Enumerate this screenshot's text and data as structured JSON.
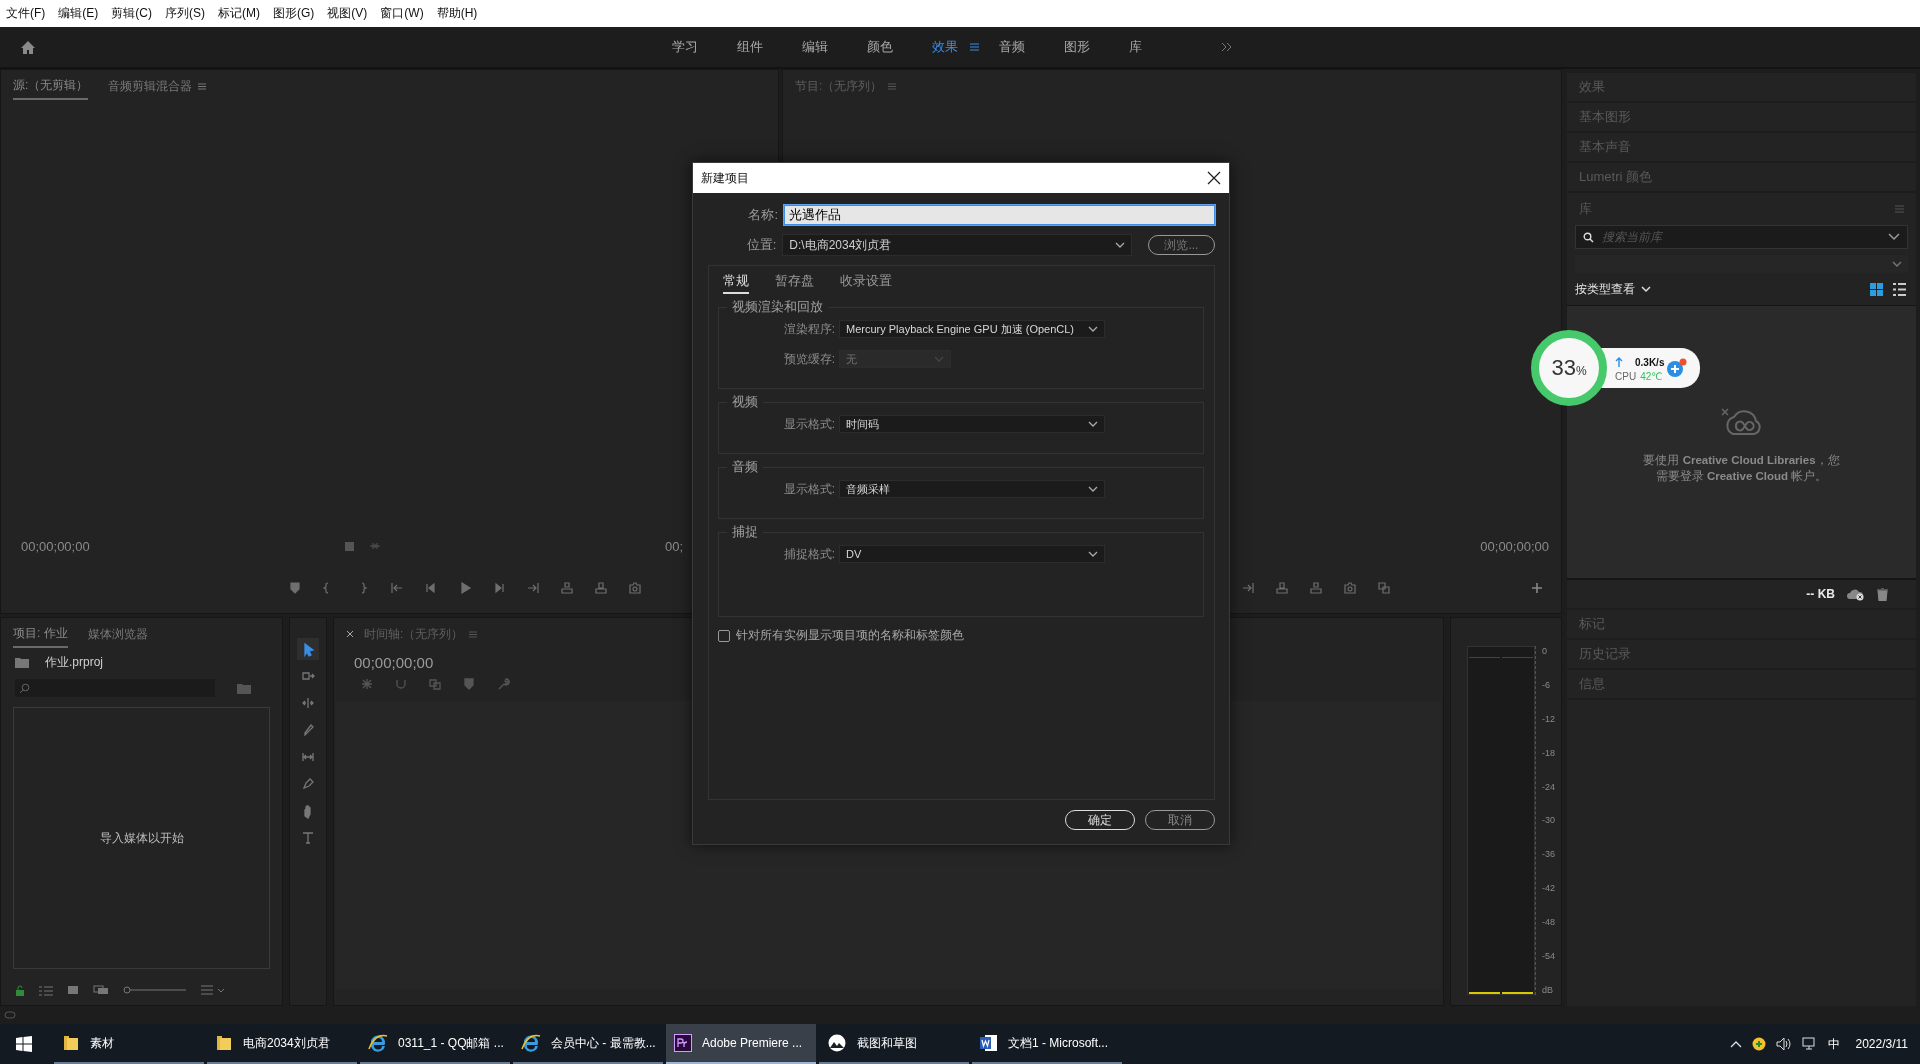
{
  "menu": [
    "文件(F)",
    "编辑(E)",
    "剪辑(C)",
    "序列(S)",
    "标记(M)",
    "图形(G)",
    "视图(V)",
    "窗口(W)",
    "帮助(H)"
  ],
  "workspaces": [
    {
      "label": "学习",
      "selected": false
    },
    {
      "label": "组件",
      "selected": false
    },
    {
      "label": "编辑",
      "selected": false
    },
    {
      "label": "颜色",
      "selected": false
    },
    {
      "label": "效果",
      "selected": true
    },
    {
      "label": "音频",
      "selected": false
    },
    {
      "label": "图形",
      "selected": false
    },
    {
      "label": "库",
      "selected": false
    }
  ],
  "source_monitor": {
    "tabs": [
      {
        "label": "源:（无剪辑）",
        "selected": true
      },
      {
        "label": "音频剪辑混合器",
        "selected": false
      }
    ],
    "timecode": "00;00;00;00",
    "timecode_right": "00;"
  },
  "program_monitor": {
    "title": "节目:（无序列）",
    "timecode_right": "00;00;00;00"
  },
  "project_panel": {
    "tabs": [
      {
        "label": "项目: 作业",
        "selected": true
      },
      {
        "label": "媒体浏览器",
        "selected": false
      }
    ],
    "file": "作业.prproj",
    "empty_message": "导入媒体以开始"
  },
  "timeline": {
    "title": "时间轴:（无序列）",
    "timecode": "00;00;00;00"
  },
  "audio_meter": {
    "ticks": [
      "0",
      "-6",
      "-12",
      "-18",
      "-24",
      "-30",
      "-36",
      "-42",
      "-48",
      "-54"
    ],
    "unit": "dB"
  },
  "right_panel": {
    "sections_top": [
      "效果",
      "基本图形",
      "基本声音",
      "Lumetri 颜色"
    ],
    "library": {
      "title": "库",
      "search_placeholder": "搜索当前库",
      "view_by": "按类型查看",
      "message": "要使用 **Creative Cloud Libraries**，您需要登录 **Creative Cloud** 帐户。",
      "storage": "-- KB"
    },
    "sections_bottom": [
      "标记",
      "历史记录",
      "信息"
    ]
  },
  "dialog": {
    "title": "新建项目",
    "name_label": "名称:",
    "name_value": "光遇作品",
    "location_label": "位置:",
    "location_value": "D:\\电商2034刘贞君",
    "browse": "浏览...",
    "tabs": [
      {
        "label": "常规",
        "selected": true
      },
      {
        "label": "暂存盘",
        "selected": false
      },
      {
        "label": "收录设置",
        "selected": false
      }
    ],
    "groups": [
      {
        "title": "视频渲染和回放",
        "rows": [
          {
            "label": "渲染程序:",
            "value": "Mercury Playback Engine GPU 加速 (OpenCL)",
            "disabled": false
          },
          {
            "label": "预览缓存:",
            "value": "无",
            "disabled": true
          }
        ]
      },
      {
        "title": "视频",
        "rows": [
          {
            "label": "显示格式:",
            "value": "时间码",
            "disabled": false
          }
        ]
      },
      {
        "title": "音频",
        "rows": [
          {
            "label": "显示格式:",
            "value": "音频采样",
            "disabled": false
          }
        ]
      },
      {
        "title": "捕捉",
        "rows": [
          {
            "label": "捕捉格式:",
            "value": "DV",
            "disabled": false
          }
        ]
      }
    ],
    "checkbox": {
      "label": "针对所有实例显示项目项的名称和标签颜色",
      "checked": false
    },
    "ok": "确定",
    "cancel": "取消"
  },
  "cpu_widget": {
    "percent": "33",
    "percent_unit": "%",
    "speed": "0.3K/s",
    "cpu_label": "CPU",
    "temperature": "42℃"
  },
  "taskbar": {
    "apps": [
      {
        "label": "素材",
        "kind": "folder",
        "selected": false
      },
      {
        "label": "电商2034刘贞君",
        "kind": "folder",
        "selected": false
      },
      {
        "label": "0311_1 - QQ邮箱 ...",
        "kind": "browser",
        "selected": false
      },
      {
        "label": "会员中心 - 最需教...",
        "kind": "browser",
        "selected": false
      },
      {
        "label": "Adobe Premiere ...",
        "kind": "editor",
        "selected": true
      },
      {
        "label": "截图和草图",
        "kind": "snipping",
        "selected": false
      },
      {
        "label": "文档1 - Microsoft...",
        "kind": "document",
        "selected": false
      }
    ],
    "ime": "中",
    "date": "2022/3/11"
  }
}
